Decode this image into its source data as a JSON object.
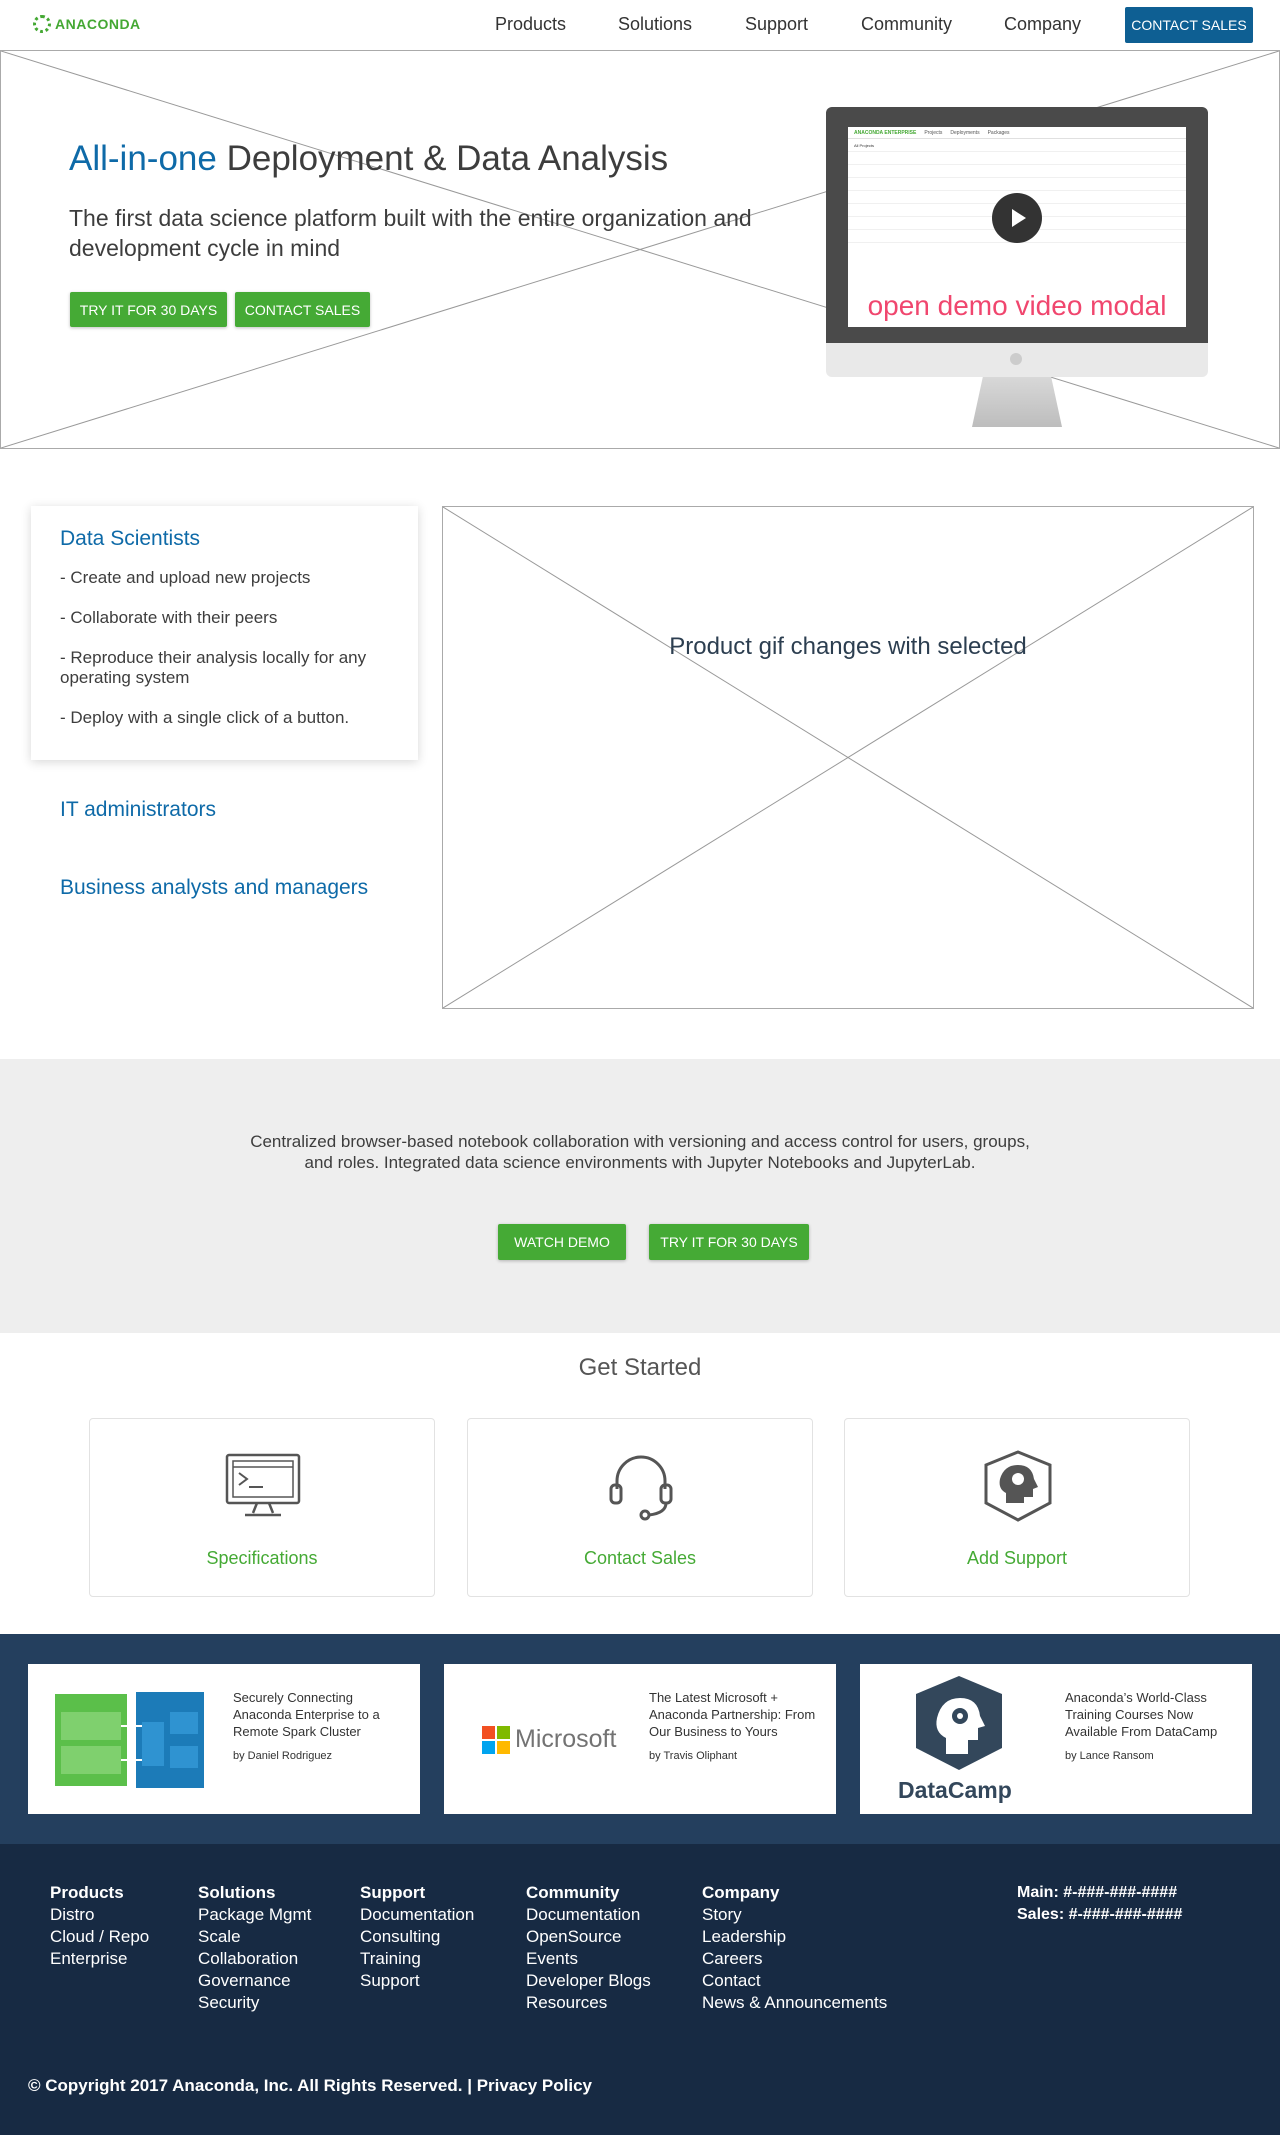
{
  "nav": {
    "logo": "ANACONDA",
    "links": [
      "Products",
      "Solutions",
      "Support",
      "Community",
      "Company"
    ],
    "cta": "CONTACT SALES"
  },
  "hero": {
    "title_highlight": "All-in-one",
    "title_rest": " Deployment & Data Analysis",
    "subtitle": "The first data science platform built with the entire organization and development cycle in mind",
    "btn_trial": "TRY IT FOR 30 DAYS",
    "btn_contact": "CONTACT SALES",
    "demo_label": "open demo video modal",
    "screen_logo": "ANACONDA ENTERPRISE",
    "screen_tabs": [
      "Projects",
      "Deployments",
      "Packages"
    ],
    "screen_dropdown": "All Projects"
  },
  "features": {
    "selected_title": "Data Scientists",
    "items": [
      "- Create and upload new projects",
      "- Collaborate with their peers",
      "- Reproduce their analysis locally for any operating system",
      "- Deploy with a single click of a button."
    ],
    "roles": [
      "IT administrators",
      "Business analysts and managers"
    ],
    "gif_placeholder": "Product gif changes with selected"
  },
  "band": {
    "text": "Centralized browser-based notebook collaboration with versioning and access control for users, groups, and roles. Integrated data science environments with Jupyter Notebooks and JupyterLab.",
    "btn_demo": "WATCH DEMO",
    "btn_trial": "TRY IT FOR 30 DAYS"
  },
  "get_started": {
    "title": "Get Started",
    "cards": [
      {
        "label": "Specifications",
        "icon": "monitor-terminal-icon"
      },
      {
        "label": "Contact Sales",
        "icon": "headset-icon"
      },
      {
        "label": "Add Support",
        "icon": "shield-head-icon"
      }
    ]
  },
  "blog": [
    {
      "title": "Securely Connecting Anaconda Enterprise to a Remote Spark Cluster",
      "author": "by Daniel Rodriguez",
      "image": "spark-cluster-diagram"
    },
    {
      "title": "The Latest Microsoft + Anaconda Partnership: From Our Business to Yours",
      "author": "by Travis Oliphant",
      "image": "microsoft-logo",
      "logo_text": "Microsoft"
    },
    {
      "title": "Anaconda’s World-Class Training Courses Now Available From DataCamp",
      "author": "by Lance Ransom",
      "image": "datacamp-logo",
      "logo_text": "DataCamp"
    }
  ],
  "footer": {
    "columns": [
      {
        "heading": "Products",
        "items": [
          "Distro",
          "Cloud / Repo",
          "Enterprise"
        ]
      },
      {
        "heading": "Solutions",
        "items": [
          "Package Mgmt",
          "Scale",
          "Collaboration",
          "Governance",
          "Security"
        ]
      },
      {
        "heading": "Support",
        "items": [
          "Documentation",
          "Consulting",
          "Training",
          "Support"
        ]
      },
      {
        "heading": "Community",
        "items": [
          "Documentation",
          "OpenSource",
          "Events",
          "Developer Blogs",
          "Resources"
        ]
      },
      {
        "heading": "Company",
        "items": [
          "Story",
          "Leadership",
          "Careers",
          "Contact",
          "News & Announcements"
        ]
      }
    ],
    "main_phone": "Main: #-###-###-####",
    "sales_phone": "Sales: #-###-###-####",
    "copyright": "© Copyright 2017 Anaconda, Inc. All Rights Reserved. |",
    "privacy": "Privacy Policy"
  },
  "colors": {
    "brand_green": "#45aa35",
    "brand_blue": "#0e6aa8",
    "nav_cta": "#0e5f93",
    "demo_label": "#f0466e",
    "blog_band": "#243f5e",
    "footer_bg": "#172a43"
  }
}
